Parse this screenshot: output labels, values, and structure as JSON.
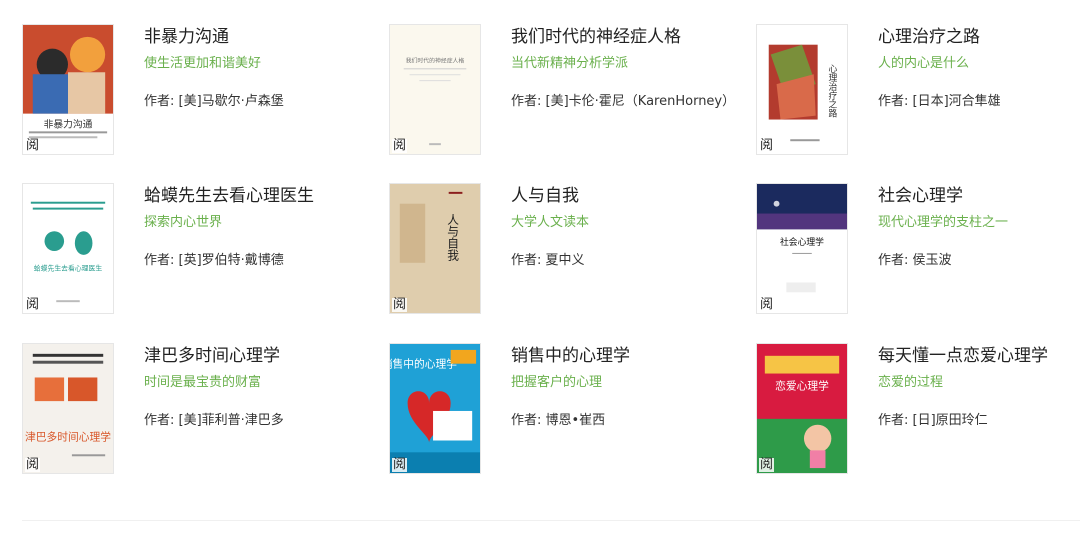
{
  "read_mark": "阅",
  "books": [
    {
      "title": "非暴力沟通",
      "subtitle": "使生活更加和谐美好",
      "author": "作者: [美]马歇尔·卢森堡",
      "cover_title": "非暴力沟通"
    },
    {
      "title": "我们时代的神经症人格",
      "subtitle": "当代新精神分析学派",
      "author": "作者: [美]卡伦·霍尼（KarenHorney）",
      "cover_title": "我们时代的神经症人格"
    },
    {
      "title": "心理治疗之路",
      "subtitle": "人的内心是什么",
      "author": "作者: [日本]河合隼雄",
      "cover_title": "心理治疗之路"
    },
    {
      "title": "蛤蟆先生去看心理医生",
      "subtitle": "探索内心世界",
      "author": "作者: [英]罗伯特·戴博德",
      "cover_title": "蛤蟆先生去看心理医生"
    },
    {
      "title": "人与自我",
      "subtitle": "大学人文读本",
      "author": "作者: 夏中义",
      "cover_title": "人与自我"
    },
    {
      "title": "社会心理学",
      "subtitle": "现代心理学的支柱之一",
      "author": "作者: 侯玉波",
      "cover_title": "社会心理学"
    },
    {
      "title": "津巴多时间心理学",
      "subtitle": "时间是最宝贵的财富",
      "author": "作者: [美]菲利普·津巴多",
      "cover_title": "津巴多时间心理学"
    },
    {
      "title": "销售中的心理学",
      "subtitle": "把握客户的心理",
      "author": "作者: 博恩•崔西",
      "cover_title": "销售中的心理学"
    },
    {
      "title": "每天懂一点恋爱心理学",
      "subtitle": "恋爱的过程",
      "author": "作者: [日]原田玲仁",
      "cover_title": "恋爱心理学"
    }
  ],
  "colors": {
    "subtitle": "#6ab04c",
    "title": "#222222",
    "author": "#333333"
  }
}
